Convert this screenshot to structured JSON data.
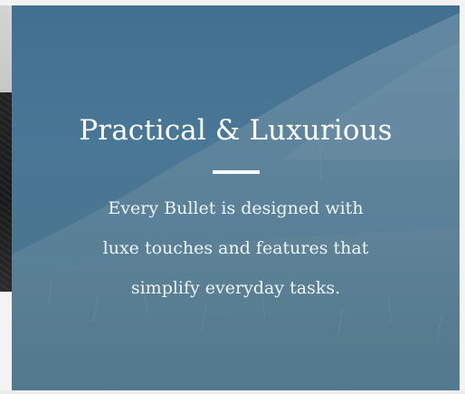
{
  "feature": {
    "title": "Practical & Luxurious",
    "description_lines": [
      "Every Bullet is designed with",
      "luxe touches and features that",
      "simplify everyday tasks."
    ]
  },
  "colors": {
    "overlay": "#4a7590",
    "text": "#ffffff"
  }
}
